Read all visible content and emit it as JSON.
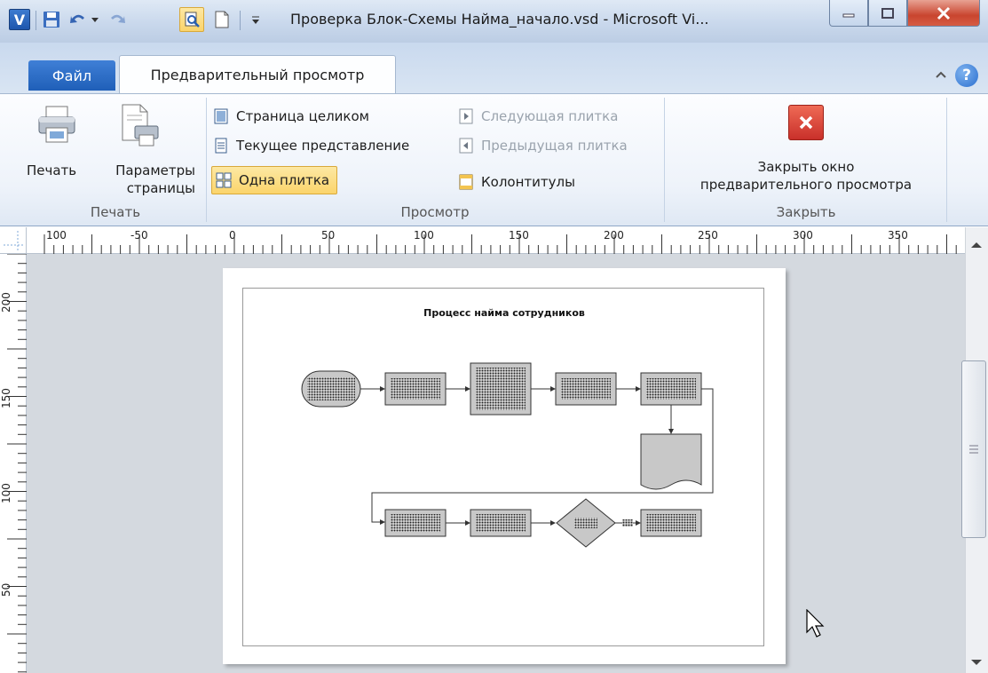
{
  "window": {
    "title": "Проверка Блок-Схемы Найма_начало.vsd  -  Microsoft Vi...",
    "app_icon": "V",
    "quick_access": [
      "save-icon",
      "undo-icon",
      "redo-icon",
      "print-preview-icon",
      "new-page-icon",
      "customize-icon"
    ],
    "controls": [
      "minimize-icon",
      "maximize-icon",
      "close-icon"
    ]
  },
  "tabs": {
    "file": "Файл",
    "preview": "Предварительный просмотр"
  },
  "ribbon": {
    "print_group": {
      "label": "Печать",
      "print": "Печать",
      "page_setup_line1": "Параметры",
      "page_setup_line2": "страницы"
    },
    "view_group": {
      "label": "Просмотр",
      "whole_page": "Страница целиком",
      "current_view": "Текущее представление",
      "single_tile": "Одна плитка",
      "next_tile": "Следующая плитка",
      "prev_tile": "Предыдущая плитка",
      "headers_footers": "Колонтитулы"
    },
    "close_group": {
      "label": "Закрыть",
      "close_line1": "Закрыть окно",
      "close_line2": "предварительного просмотра"
    }
  },
  "rulers": {
    "horizontal": [
      "100",
      "-50",
      "0",
      "50",
      "100",
      "150",
      "200",
      "250",
      "300",
      "350"
    ],
    "vertical": [
      "200",
      "150",
      "100",
      "50"
    ]
  },
  "diagram": {
    "title": "Процесс найма сотрудников"
  },
  "colors": {
    "accent": "#2a6fcf",
    "close_red": "#d9302a",
    "highlight": "#fbd46b"
  }
}
